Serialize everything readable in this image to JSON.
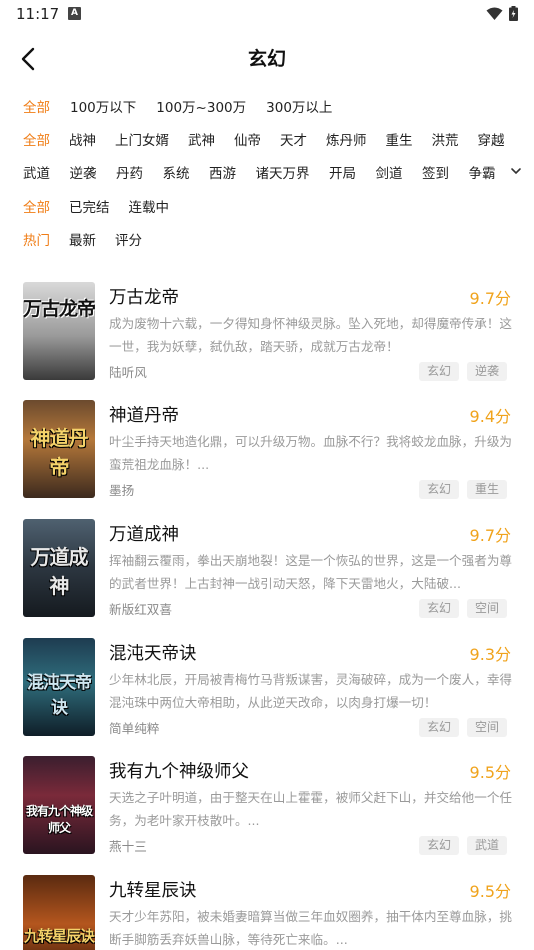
{
  "status": {
    "time": "11:17",
    "a_badge": "A"
  },
  "nav": {
    "title": "玄幻"
  },
  "filters": {
    "words": [
      "全部",
      "100万以下",
      "100万~300万",
      "300万以上"
    ],
    "genres_row1": [
      "全部",
      "战神",
      "上门女婿",
      "武神",
      "仙帝",
      "天才",
      "炼丹师",
      "重生",
      "洪荒",
      "穿越"
    ],
    "genres_row2": [
      "武道",
      "逆袭",
      "丹药",
      "系统",
      "西游",
      "诸天万界",
      "开局",
      "剑道",
      "签到",
      "争霸"
    ],
    "status": [
      "全部",
      "已完结",
      "连载中"
    ],
    "sort": [
      "热门",
      "最新",
      "评分"
    ]
  },
  "accent_color": "#f07d16",
  "score_color": "#f0a31c",
  "books": [
    {
      "title": "万古龙帝",
      "score": "9.7分",
      "desc": "成为废物十六载，一夕得知身怀神级灵脉。坠入死地，却得魔帝传承！这一世，我为妖孽，弑仇敌，踏天骄，成就万古龙帝！",
      "author": "陆听风",
      "tags": [
        "玄幻",
        "逆袭"
      ],
      "cover_text": "万古龙帝"
    },
    {
      "title": "神道丹帝",
      "score": "9.4分",
      "desc": "叶尘手持天地造化鼎，可以升级万物。血脉不行？我将蛟龙血脉，升级为蛮荒祖龙血脉！...",
      "author": "墨扬",
      "tags": [
        "玄幻",
        "重生"
      ],
      "cover_text": "神道丹帝"
    },
    {
      "title": "万道成神",
      "score": "9.7分",
      "desc": "挥袖翻云覆雨，拳出天崩地裂！这是一个恢弘的世界，这是一个强者为尊的武者世界！上古封神一战引动天怒，降下天雷地火，大陆破...",
      "author": "新版红双喜",
      "tags": [
        "玄幻",
        "空间"
      ],
      "cover_text": "万道成神"
    },
    {
      "title": "混沌天帝诀",
      "score": "9.3分",
      "desc": "少年林北辰，开局被青梅竹马背叛谋害，灵海破碎，成为一个废人，幸得混沌珠中两位大帝相助，从此逆天改命，以肉身打爆一切！",
      "author": "简单纯粹",
      "tags": [
        "玄幻",
        "空间"
      ],
      "cover_text": "混沌天帝诀"
    },
    {
      "title": "我有九个神级师父",
      "score": "9.5分",
      "desc": "天选之子叶明道，由于整天在山上霍霍，被师父赶下山，并交给他一个任务，为老叶家开枝散叶。...",
      "author": "燕十三",
      "tags": [
        "玄幻",
        "武道"
      ],
      "cover_text": "我有九个神级师父"
    },
    {
      "title": "九转星辰诀",
      "score": "9.5分",
      "desc": "天才少年苏阳，被未婚妻暗算当做三年血奴圈养，抽干体内至尊血脉，挑断手脚筋丢弃妖兽山脉，等待死亡来临。...",
      "author": "",
      "tags": [],
      "cover_text": "九转星辰诀"
    }
  ]
}
